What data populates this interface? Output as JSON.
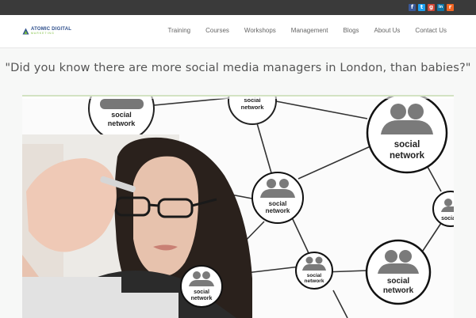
{
  "topbar": {
    "social_icons": [
      {
        "name": "facebook-icon",
        "glyph": "f",
        "color": "#3b5998"
      },
      {
        "name": "twitter-icon",
        "glyph": "t",
        "color": "#1da1f2"
      },
      {
        "name": "google-plus-icon",
        "glyph": "g",
        "color": "#d34836"
      },
      {
        "name": "linkedin-icon",
        "glyph": "in",
        "color": "#0e76a8"
      },
      {
        "name": "rss-icon",
        "glyph": "r",
        "color": "#f26522"
      }
    ]
  },
  "header": {
    "logo_top": "ATOMIC DIGITAL",
    "logo_bottom": "MARKETING",
    "nav": [
      "Training",
      "Courses",
      "Workshops",
      "Management",
      "Blogs",
      "About Us",
      "Contact Us"
    ]
  },
  "hero": {
    "quote": "\"Did you know there are more social media managers in London, than babies?\"",
    "node_line1": "social",
    "node_line2": "network"
  },
  "colors": {
    "topbar": "#3a3a3a",
    "accent_green": "#7bbf3e",
    "logo_blue": "#2e4f8c"
  }
}
